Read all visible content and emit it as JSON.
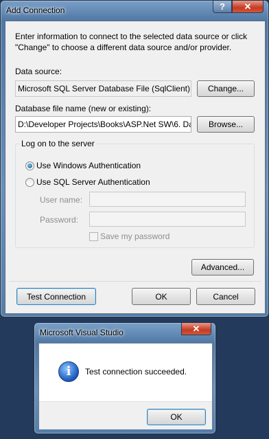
{
  "add_connection": {
    "title": "Add Connection",
    "help_glyph": "?",
    "close_glyph": "✕",
    "intro": "Enter information to connect to the selected data source or click \"Change\" to choose a different data source and/or provider.",
    "data_source_label": "Data source:",
    "data_source_value": "Microsoft SQL Server Database File (SqlClient)",
    "change_label": "Change...",
    "db_file_label": "Database file name (new or existing):",
    "db_file_value": "D:\\Developer Projects\\Books\\ASP.Net SW\\6. Da",
    "browse_label": "Browse...",
    "logon_legend": "Log on to the server",
    "windows_auth_label": "Use Windows Authentication",
    "sql_auth_label": "Use SQL Server Authentication",
    "username_label": "User name:",
    "password_label": "Password:",
    "save_password_label": "Save my password",
    "auth_selected": "windows",
    "advanced_label": "Advanced...",
    "test_connection_label": "Test Connection",
    "ok_label": "OK",
    "cancel_label": "Cancel"
  },
  "message_box": {
    "title": "Microsoft Visual Studio",
    "close_glyph": "✕",
    "icon_glyph": "i",
    "message": "Test connection succeeded.",
    "ok_label": "OK"
  }
}
